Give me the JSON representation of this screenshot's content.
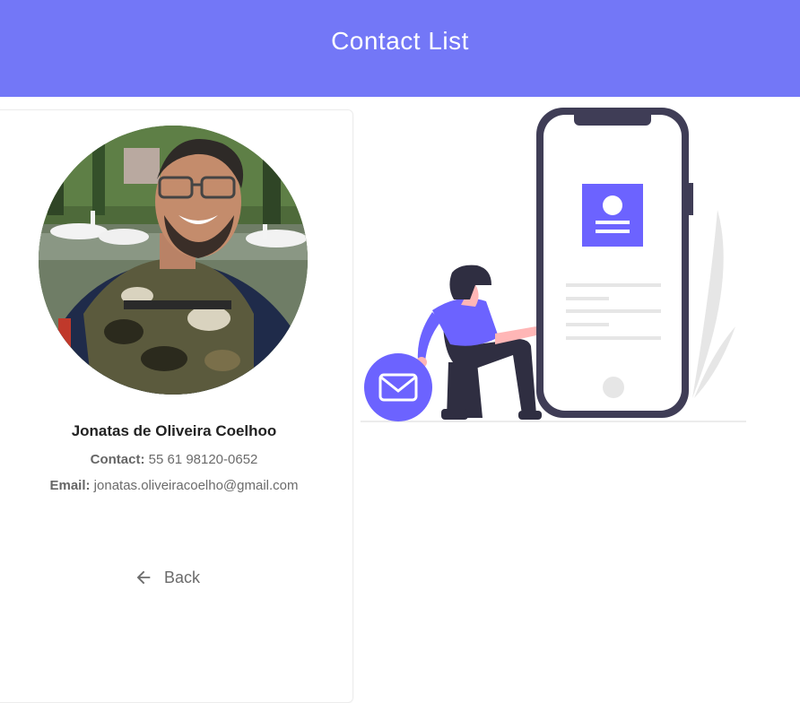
{
  "header": {
    "title": "Contact List"
  },
  "contact": {
    "name": "Jonatas de Oliveira Coelhoo",
    "contact_label": "Contact:",
    "contact_value": "55 61 98120-0652",
    "email_label": "Email:",
    "email_value": "jonatas.oliveiracoelho@gmail.com",
    "avatar_icon": "profile-photo"
  },
  "actions": {
    "back_label": "Back",
    "back_icon": "arrow-left-icon"
  },
  "colors": {
    "header_bg": "#7377f7",
    "accent": "#6c63ff",
    "phone_dark": "#3f3d56"
  }
}
